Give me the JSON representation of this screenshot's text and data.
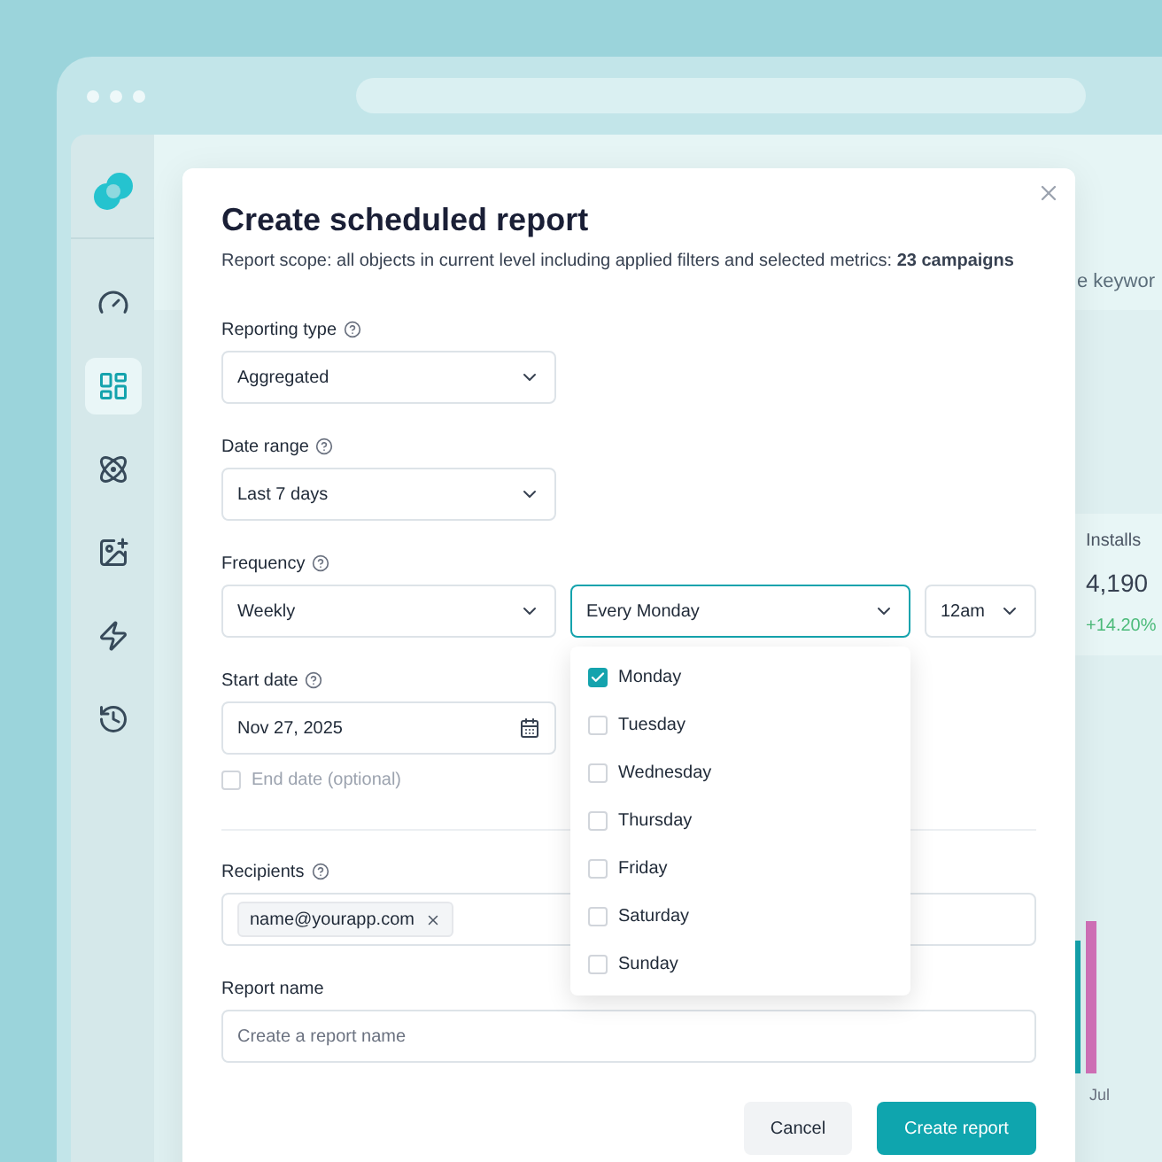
{
  "sidebar": {
    "items": [
      {
        "selected": false
      },
      {
        "selected": true
      },
      {
        "selected": false
      },
      {
        "selected": false
      },
      {
        "selected": false
      },
      {
        "selected": false
      }
    ]
  },
  "background": {
    "header_text": "e keywor",
    "metric": {
      "label": "Installs",
      "value": "4,190",
      "change": "+14.20%"
    },
    "chart_label": "Jul"
  },
  "dialog": {
    "title": "Create scheduled report",
    "scope": "Report scope: all objects in current level including applied filters and selected metrics: **23 campaigns**",
    "reporting_type": {
      "label": "Reporting type",
      "value": "Aggregated"
    },
    "date_range": {
      "label": "Date range",
      "value": "Last 7 days"
    },
    "frequency": {
      "label": "Frequency",
      "value": "Weekly",
      "day": "Every Monday",
      "time": "12am",
      "expanded": true,
      "options": [
        {
          "label": "Monday",
          "checked": true
        },
        {
          "label": "Tuesday",
          "checked": false
        },
        {
          "label": "Wednesday",
          "checked": false
        },
        {
          "label": "Thursday",
          "checked": false
        },
        {
          "label": "Friday",
          "checked": false
        },
        {
          "label": "Saturday",
          "checked": false
        },
        {
          "label": "Sunday",
          "checked": false
        }
      ]
    },
    "start_date": {
      "label": "Start date",
      "value": "Nov 27, 2025"
    },
    "end_date": {
      "label": "End date (optional)",
      "checked": false
    },
    "recipients": {
      "label": "Recipients",
      "chips": [
        "name@yourapp.com"
      ]
    },
    "report_name": {
      "label": "Report name",
      "placeholder": "Create a report name"
    },
    "buttons": {
      "cancel": "Cancel",
      "submit": "Create report"
    }
  }
}
